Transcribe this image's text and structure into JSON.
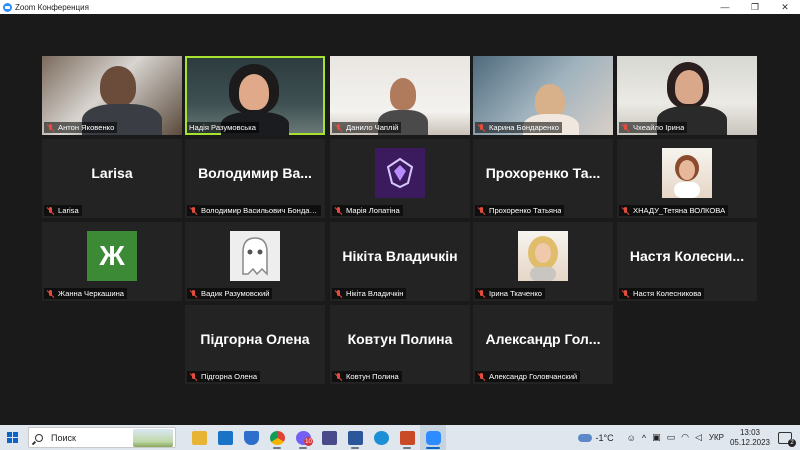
{
  "window": {
    "title": "Zoom Конференция",
    "controls": {
      "minimize": "—",
      "restore": "❐",
      "close": "✕"
    }
  },
  "tiles": [
    {
      "id": "t1",
      "type": "video",
      "name": "Антон Яковенко",
      "muted": true
    },
    {
      "id": "t2",
      "type": "video",
      "name": "Надія Разумовська",
      "muted": false,
      "active_speaker": true
    },
    {
      "id": "t3",
      "type": "video",
      "name": "Данило Чаплій",
      "muted": true
    },
    {
      "id": "t4",
      "type": "video",
      "name": "Карина Бондаренко",
      "muted": true
    },
    {
      "id": "t5",
      "type": "video",
      "name": "Чхеайло Ірина",
      "muted": true
    },
    {
      "id": "t6",
      "type": "text",
      "display": "Larisa",
      "name": "Larisa",
      "muted": true
    },
    {
      "id": "t7",
      "type": "text",
      "display": "Володимир Ва...",
      "name": "Володимир Васильович Бондаре...",
      "muted": true
    },
    {
      "id": "t8",
      "type": "avatar",
      "avatar": "purple-emblem",
      "name": "Марія Лопатіна",
      "muted": true
    },
    {
      "id": "t9",
      "type": "text",
      "display": "Прохоренко Та...",
      "name": "Прохоренко Татьяна",
      "muted": true
    },
    {
      "id": "t10",
      "type": "avatar",
      "avatar": "photo-woman",
      "name": "ХНАДУ_Тетяна ВОЛКОВА",
      "muted": true
    },
    {
      "id": "t11",
      "type": "avatar",
      "avatar": "letter",
      "letter": "Ж",
      "name": "Жанна Черкашина",
      "muted": true
    },
    {
      "id": "t12",
      "type": "avatar",
      "avatar": "ghost",
      "name": "Вадик Разумовский",
      "muted": true
    },
    {
      "id": "t13",
      "type": "text",
      "display": "Нікіта Владичкін",
      "name": "Нікіта Владичкін",
      "muted": true
    },
    {
      "id": "t14",
      "type": "avatar",
      "avatar": "photo-blonde",
      "name": "Ірина Ткаченко",
      "muted": true
    },
    {
      "id": "t15",
      "type": "text",
      "display": "Настя Колесни...",
      "name": "Настя Колесникова",
      "muted": true
    },
    {
      "id": "t16",
      "type": "text",
      "display": "Підгорна Олена",
      "name": "Підгорна Олена",
      "muted": true
    },
    {
      "id": "t17",
      "type": "text",
      "display": "Ковтун Полина",
      "name": "Ковтун Полина",
      "muted": true
    },
    {
      "id": "t18",
      "type": "text",
      "display": "Александр Гол...",
      "name": "Александр Головчанский",
      "muted": true
    }
  ],
  "taskbar": {
    "search_label": "Поиск",
    "apps": [
      {
        "name": "file-explorer-icon",
        "color": "#e8b436"
      },
      {
        "name": "mail-icon",
        "color": "#1a73c7"
      },
      {
        "name": "defender-icon",
        "color": "#2f6fcc"
      },
      {
        "name": "chrome-icon",
        "color": "#db4437"
      },
      {
        "name": "viber-icon",
        "color": "#7360f2",
        "badge": "10"
      },
      {
        "name": "save-icon",
        "color": "#4a4a8a"
      },
      {
        "name": "word-icon",
        "color": "#2b579a"
      },
      {
        "name": "edge-icon",
        "color": "#1d8fd6"
      },
      {
        "name": "pdf-icon",
        "color": "#c84a26"
      },
      {
        "name": "zoom-icon",
        "color": "#2d8cff"
      }
    ],
    "weather": "-1°C",
    "language": "УКР",
    "time": "13:03",
    "date": "05.12.2023",
    "notifications": "2"
  },
  "colors": {
    "active_speaker_border": "#a6e22e",
    "muted_icon": "#e64b3c",
    "tile_bg": "#232323",
    "meeting_bg": "#1a1a1a"
  }
}
